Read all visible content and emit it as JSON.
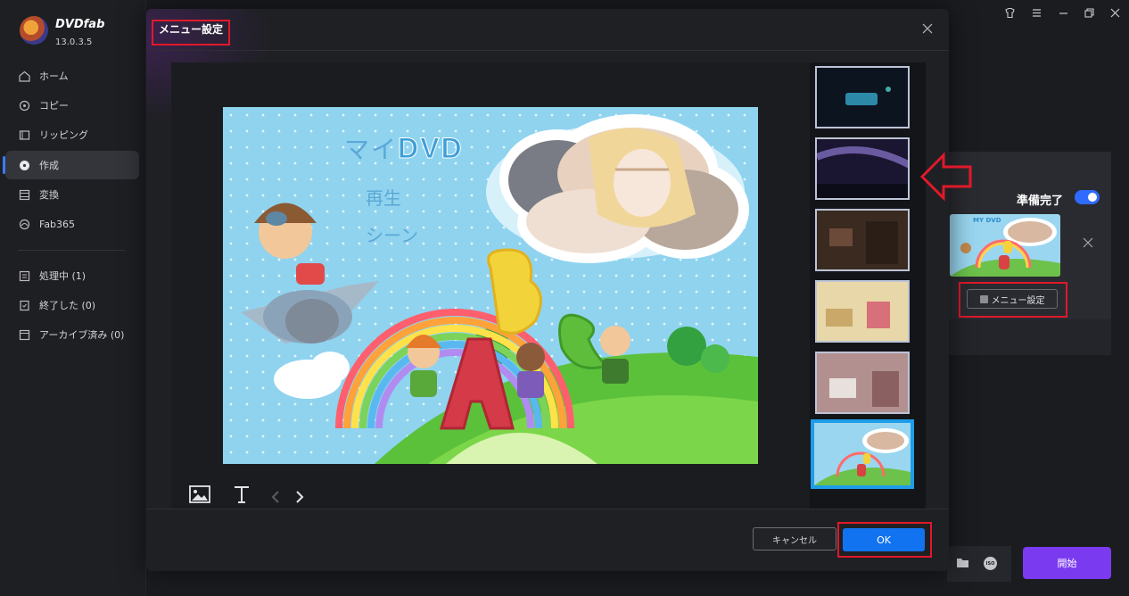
{
  "app": {
    "brand": "DVDfab",
    "version": "13.0.3.5"
  },
  "sidebar": {
    "items": [
      {
        "label": "ホーム",
        "icon": "home-icon"
      },
      {
        "label": "コピー",
        "icon": "copy-icon"
      },
      {
        "label": "リッピング",
        "icon": "ripper-icon"
      },
      {
        "label": "作成",
        "icon": "creator-icon",
        "active": true
      },
      {
        "label": "変換",
        "icon": "convert-icon"
      },
      {
        "label": "Fab365",
        "icon": "fab365-icon"
      }
    ],
    "queue": [
      {
        "label": "処理中 (1)",
        "icon": "processing-icon"
      },
      {
        "label": "終了した (0)",
        "icon": "finished-icon"
      },
      {
        "label": "アーカイブ済み (0)",
        "icon": "archive-icon"
      }
    ]
  },
  "task": {
    "ready_label": "準備完了",
    "ready_enabled": true,
    "menu_settings_label": "メニュー設定",
    "start_label": "開始"
  },
  "modal": {
    "title": "メニュー設定",
    "cancel_label": "キャンセル",
    "ok_label": "OK",
    "preview": {
      "title_jp": "マイ",
      "title_dvd": "DVD",
      "play": "再生",
      "scene": "シーン"
    },
    "templates_selected_index": 5
  },
  "colors": {
    "accent": "#1273f0",
    "start_button": "#7a3bf0",
    "highlight": "#e0192a",
    "selected_thumb": "#1e9de8"
  }
}
